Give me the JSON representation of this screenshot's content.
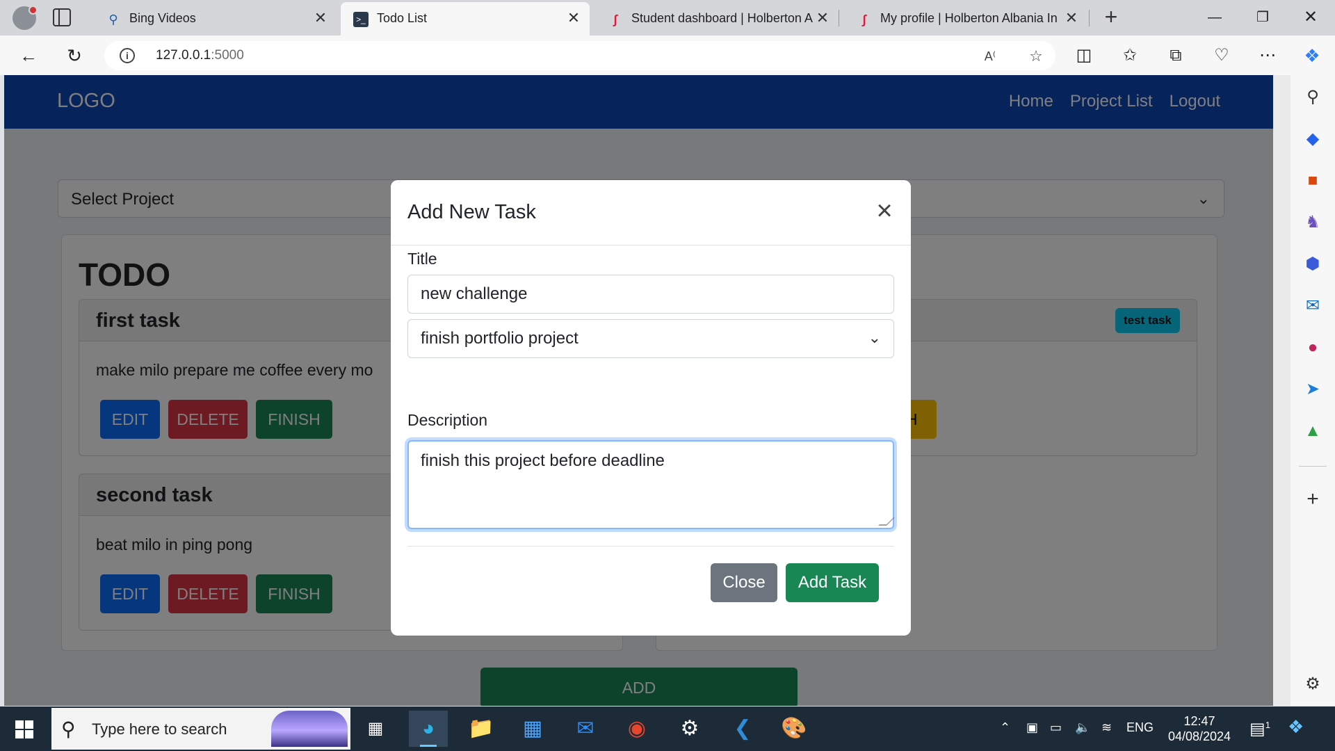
{
  "browser": {
    "tabs": [
      {
        "title": "Bing Videos",
        "icon": "search-icon"
      },
      {
        "title": "Todo List",
        "icon": "terminal-icon"
      },
      {
        "title": "Student dashboard | Holberton A",
        "icon": "holberton-icon"
      },
      {
        "title": "My profile | Holberton Albania In",
        "icon": "holberton-icon"
      }
    ],
    "url_host": "127.0.0.1",
    "url_port": ":5000"
  },
  "navbar": {
    "logo": "LOGO",
    "links": [
      "Home",
      "Project List",
      "Logout"
    ]
  },
  "project_select": {
    "value": "Select Project"
  },
  "todo": {
    "heading": "TODO",
    "tasks": [
      {
        "title": "first task",
        "description": "make milo prepare me coffee every mo"
      },
      {
        "title": "second task",
        "description": "beat milo in ping pong"
      }
    ]
  },
  "right_column": {
    "badge": "test task",
    "button_fragment": "NISH"
  },
  "task_buttons": {
    "edit": "EDIT",
    "delete": "DELETE",
    "finish": "FINISH"
  },
  "add_button": "ADD",
  "modal": {
    "title": "Add New Task",
    "title_label": "Title",
    "title_value": "new challenge",
    "project_value": "finish portfolio project",
    "description_label": "Description",
    "description_value": "finish this project before deadline",
    "close_label": "Close",
    "add_label": "Add Task"
  },
  "taskbar": {
    "search_placeholder": "Type here to search",
    "language": "ENG",
    "time": "12:47",
    "date": "04/08/2024",
    "notification_count": "1"
  },
  "colors": {
    "navbar": "#0d47b8",
    "primary": "#0d6efd",
    "danger": "#dc3545",
    "success": "#198754",
    "secondary": "#6c757d",
    "info": "#0dcaf0",
    "warning": "#ffc107"
  }
}
